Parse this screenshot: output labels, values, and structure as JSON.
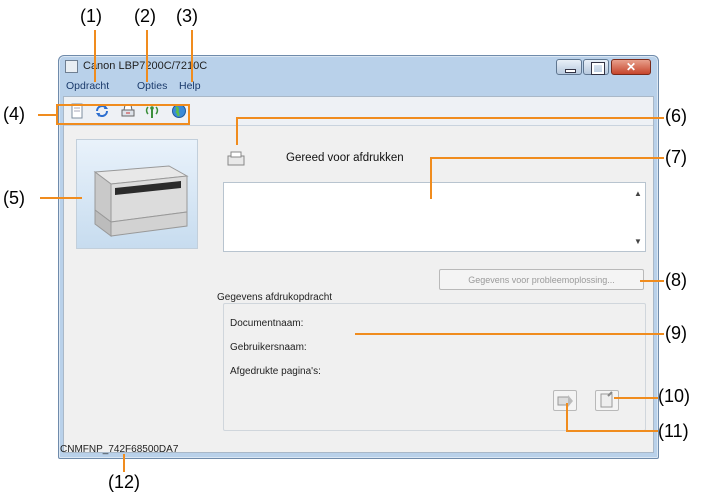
{
  "window": {
    "title": "Canon LBP7200C/7210C",
    "menu": [
      "Opdracht",
      "Opties",
      "Help"
    ]
  },
  "toolbar": {
    "buttons": [
      "document-icon",
      "refresh-icon",
      "printer-settings-icon",
      "wireless-icon",
      "web-globe-icon"
    ]
  },
  "status": {
    "message": "Gereed voor afdrukken",
    "troubleshoot_button": "Gegevens voor probleemoplossing..."
  },
  "job_info": {
    "group_title": "Gegevens afdrukopdracht",
    "fields": [
      "Documentnaam:",
      "Gebruikersnaam:",
      "Afgedrukte pagina's:"
    ]
  },
  "statusbar": {
    "device": "CNMFNP_742F68500DA7"
  },
  "callouts": [
    "(1)",
    "(2)",
    "(3)",
    "(4)",
    "(5)",
    "(6)",
    "(7)",
    "(8)",
    "(9)",
    "(10)",
    "(11)",
    "(12)"
  ],
  "colors": {
    "callout_line": "#f08c1e",
    "window_frame": "#b9d1ea",
    "client_bg": "#f0f0f0"
  }
}
